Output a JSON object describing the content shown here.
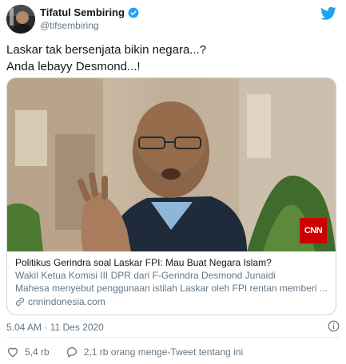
{
  "tweet": {
    "author": {
      "display_name": "Tifatul Sembiring",
      "handle": "@tifsembiring",
      "avatar_icon": "avatar-photo",
      "verified_icon": "verified-badge-icon"
    },
    "platform_icon": "twitter-bird-icon",
    "text_lines": [
      "Laskar tak bersenjata bikin negara...?",
      "Anda lebayy Desmond...!"
    ],
    "card": {
      "image_logo": "CNN",
      "title": "Politikus Gerindra soal Laskar FPI: Mau Buat Negara Islam?",
      "description_lines": [
        "Wakil Ketua Komisi III DPR dari F-Gerindra Desmond Junaidi",
        "Mahesa menyebut penggunaan istilah Laskar oleh FPI rentan memberi ..."
      ],
      "domain": "cnnindonesia.com",
      "link_icon": "link-icon"
    },
    "timestamp": "5.04 AM · 11 Des 2020",
    "info_icon": "info-icon",
    "likes_count": "5,4 rb",
    "retweet_text": "2,1 rb orang menge-Tweet tentang ini"
  },
  "colors": {
    "brand_blue": "#1da1f2",
    "secondary_text": "#657786",
    "primary_text": "#14171a",
    "border": "#ccd6dd",
    "cnn_red": "#cc0000"
  }
}
